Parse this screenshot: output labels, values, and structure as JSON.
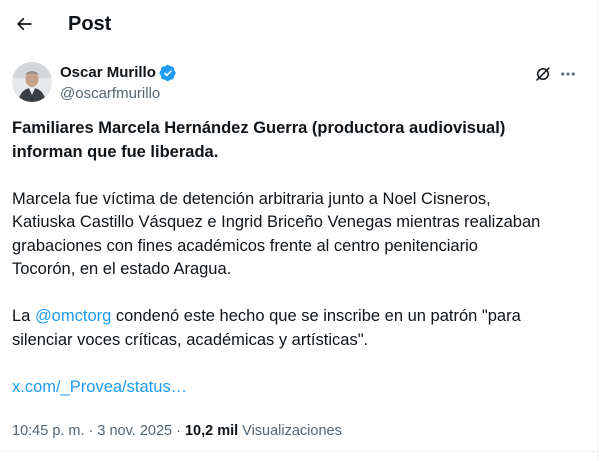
{
  "header": {
    "title": "Post"
  },
  "author": {
    "name": "Oscar Murillo",
    "handle": "@oscarfmurillo",
    "verified": true,
    "verified_color": "#1d9bf0"
  },
  "tweet": {
    "headline_line1": "Familiares Marcela Hernández Guerra (productora audiovisual)",
    "headline_line2": "informan que fue liberada.",
    "body_lines": [
      "Marcela fue víctima de detención arbitraria junto a Noel Cisneros,",
      "Katiuska Castillo Vásquez e Ingrid Briceño Venegas mientras realizaban",
      "grabaciones con fines académicos frente al centro penitenciario",
      "Tocorón, en el estado Aragua."
    ],
    "mention_prefix": "La ",
    "mention": "@omctorg",
    "mention_suffix": " condenó este hecho que se inscribe en un patrón \"para",
    "mention_line2": "silenciar voces críticas, académicas y artísticas\".",
    "link": "x.com/_Provea/status…"
  },
  "meta": {
    "time": "10:45 p. m.",
    "date": "3 nov. 2025",
    "views_count": "10,2 mil",
    "views_label": "Visualizaciones",
    "separator": "·"
  },
  "colors": {
    "accent": "#1d9bf0",
    "secondary_text": "#536471",
    "primary_text": "#0f1419"
  },
  "icons": {
    "back": "arrow-left-icon",
    "grok": "grok-icon",
    "more": "more-icon",
    "verified": "verified-badge-icon"
  }
}
